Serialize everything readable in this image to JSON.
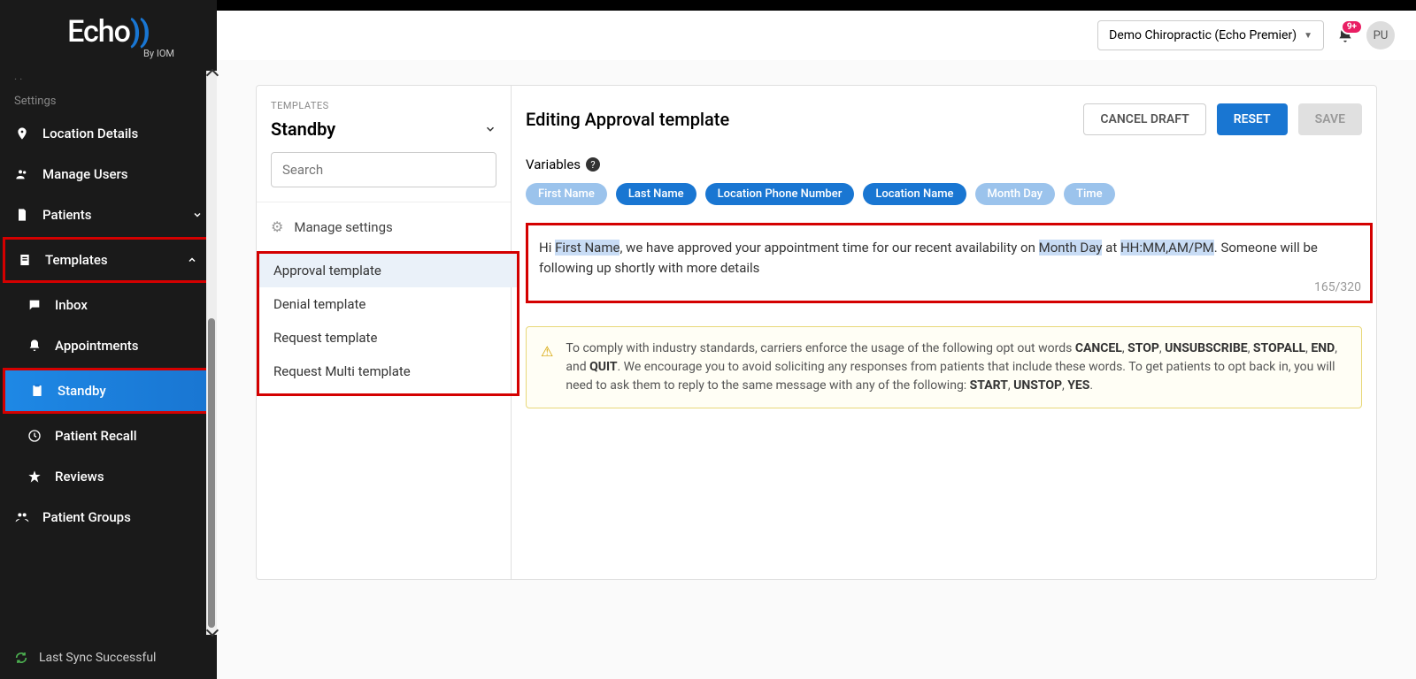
{
  "logo": {
    "brand": "Echo",
    "sub": "By IOM"
  },
  "sidebar": {
    "section_label": "Settings",
    "items": {
      "location": "Location Details",
      "users": "Manage Users",
      "patients": "Patients",
      "templates": "Templates",
      "inbox": "Inbox",
      "appointments": "Appointments",
      "standby": "Standby",
      "recall": "Patient Recall",
      "reviews": "Reviews",
      "groups": "Patient Groups"
    },
    "sync": "Last Sync Successful"
  },
  "header": {
    "org": "Demo Chiropractic (Echo Premier)",
    "badge": "9+",
    "avatar": "PU"
  },
  "templates_panel": {
    "label": "TEMPLATES",
    "category": "Standby",
    "search_placeholder": "Search",
    "manage": "Manage settings",
    "list": {
      "approval": "Approval template",
      "denial": "Denial template",
      "request": "Request template",
      "request_multi": "Request Multi template"
    }
  },
  "editor": {
    "title": "Editing Approval template",
    "buttons": {
      "cancel": "CANCEL DRAFT",
      "reset": "RESET",
      "save": "SAVE"
    },
    "variables_label": "Variables",
    "chips": {
      "first_name": "First Name",
      "last_name": "Last Name",
      "phone": "Location Phone Number",
      "loc_name": "Location Name",
      "month_day": "Month Day",
      "time": "Time"
    },
    "message": {
      "p1": "Hi ",
      "v1": "First Name",
      "p2": ", we have approved your appointment time for our recent availability on ",
      "v2": "Month Day",
      "p3": " at ",
      "v3": "HH:MM,AM/PM",
      "p4": ". Someone will be following up shortly with more details"
    },
    "counter": "165/320",
    "warning": {
      "pre": "To comply with industry standards, carriers enforce the usage of the following opt out words ",
      "w1": "CANCEL",
      "w2": "STOP",
      "w3": "UNSUBSCRIBE",
      "w4": "STOPALL",
      "w5": "END",
      "w6": "QUIT",
      "mid": ". We encourage you to avoid soliciting any responses from patients that include these words. To get patients to opt back in, you will need to ask them to reply to the same message with any of the following: ",
      "o1": "START",
      "o2": "UNSTOP",
      "o3": "YES",
      "end": "."
    }
  }
}
